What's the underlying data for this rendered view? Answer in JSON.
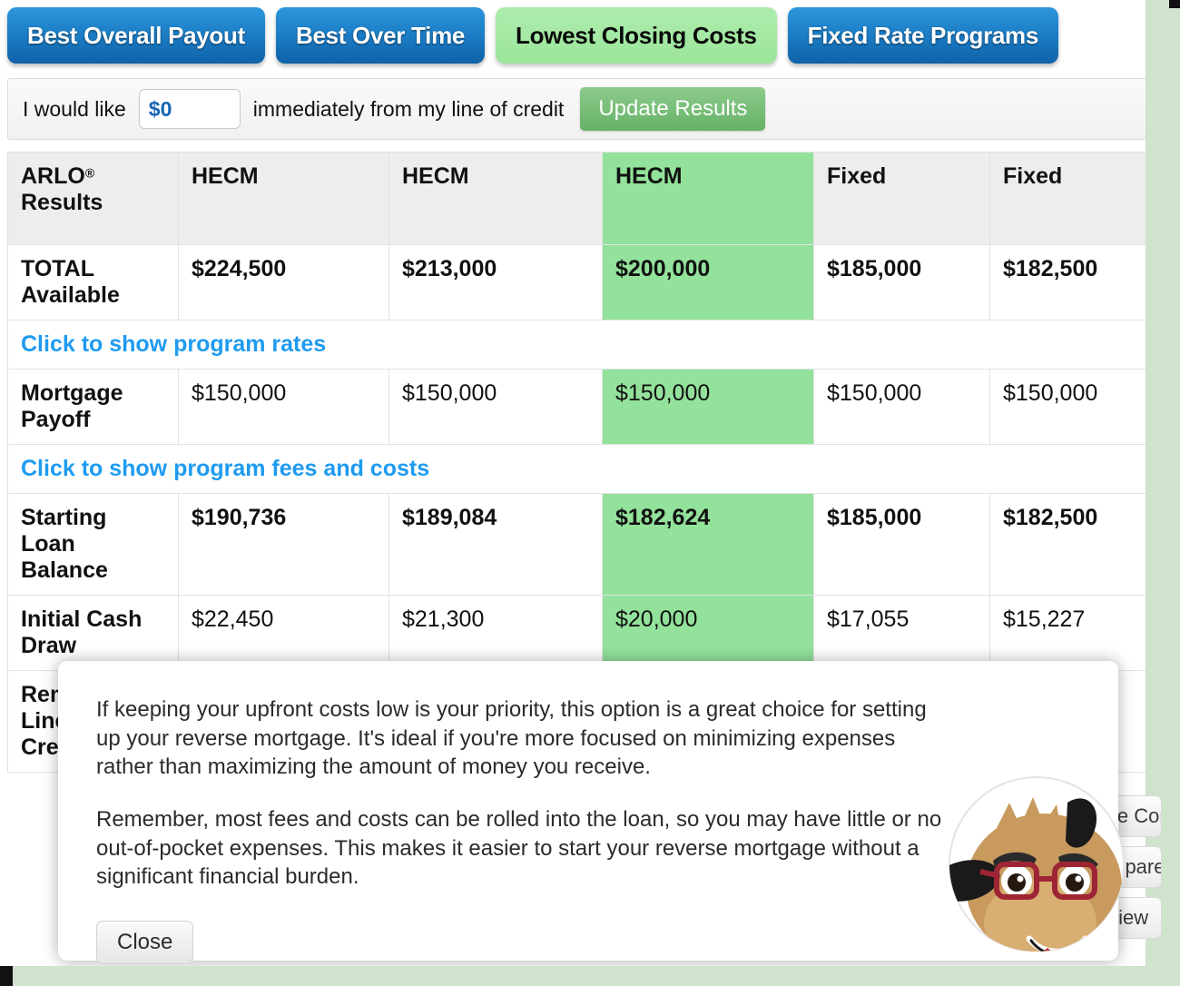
{
  "tabs": [
    {
      "label": "Best Overall Payout",
      "active": false
    },
    {
      "label": "Best Over Time",
      "active": false
    },
    {
      "label": "Lowest Closing Costs",
      "active": true
    },
    {
      "label": "Fixed Rate Programs",
      "active": false
    }
  ],
  "draw_bar": {
    "prefix": "I would like",
    "amount_value": "$0",
    "amount_placeholder": "$0",
    "suffix": "immediately from my line of credit",
    "update_button": "Update Results"
  },
  "table": {
    "headers": [
      "ARLO",
      "HECM",
      "HECM",
      "HECM",
      "Fixed",
      "Fixed"
    ],
    "header_first_mark": "®",
    "header_first_line2": "Results",
    "highlight_column_index": 3,
    "rows": [
      {
        "label": "TOTAL Available",
        "bold": true,
        "values": [
          "$224,500",
          "$213,000",
          "$200,000",
          "$185,000",
          "$182,500"
        ]
      },
      {
        "label": "Mortgage Payoff",
        "bold": false,
        "values": [
          "$150,000",
          "$150,000",
          "$150,000",
          "$150,000",
          "$150,000"
        ]
      },
      {
        "label": "Starting Loan Balance",
        "bold": true,
        "values": [
          "$190,736",
          "$189,084",
          "$182,624",
          "$185,000",
          "$182,500"
        ]
      },
      {
        "label": "Initial Cash Draw",
        "bold": false,
        "values": [
          "$22,450",
          "$21,300",
          "$20,000",
          "$17,055",
          "$15,227"
        ]
      },
      {
        "label": "Remaining Line of Credit",
        "bold": false,
        "values": [
          "",
          "",
          "",
          "",
          ""
        ]
      }
    ],
    "disclosure_rates": "Click to show program rates",
    "disclosure_fees": "Click to show program fees and costs"
  },
  "side_actions": [
    {
      "label": "Save Comparison"
    },
    {
      "label": "Compare"
    },
    {
      "label": "Review"
    }
  ],
  "modal": {
    "paragraph1": "If keeping your upfront costs low is your priority, this option is a great choice for setting up your reverse mortgage. It's ideal if you're more focused on minimizing expenses rather than maximizing the amount of money you receive.",
    "paragraph2": "Remember, most fees and costs can be rolled into the loan, so you may have little or no out-of-pocket expenses. This makes it easier to start your reverse mortgage without a significant financial burden.",
    "close_label": "Close"
  },
  "colors": {
    "highlight_green": "#93E29B",
    "tab_active_green": "#9BE59B",
    "tab_blue": "#1C7FC7",
    "link_blue": "#1E9BF0",
    "update_green": "#66B266",
    "page_accent": "#cfe3cd"
  }
}
